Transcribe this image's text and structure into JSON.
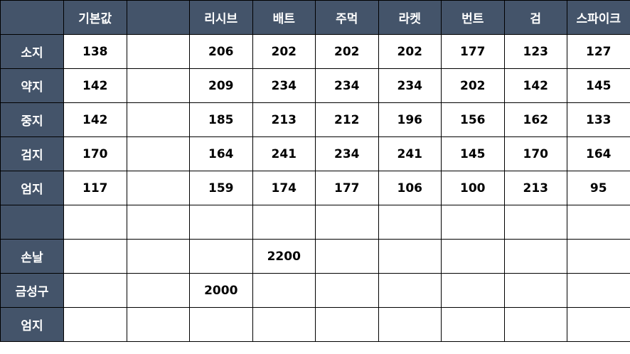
{
  "colors": {
    "header_bg": "#44546a",
    "header_text": "#ffffff",
    "cell_text": "#000000",
    "border": "#000000"
  },
  "table": {
    "columns": [
      "",
      "기본값",
      "",
      "리시브",
      "배트",
      "주먹",
      "라켓",
      "번트",
      "검",
      "스파이크"
    ],
    "rows": [
      {
        "label": "소지",
        "cells": [
          "138",
          "",
          "206",
          "202",
          "202",
          "202",
          "177",
          "123",
          "127"
        ]
      },
      {
        "label": "약지",
        "cells": [
          "142",
          "",
          "209",
          "234",
          "234",
          "234",
          "202",
          "142",
          "145"
        ]
      },
      {
        "label": "중지",
        "cells": [
          "142",
          "",
          "185",
          "213",
          "212",
          "196",
          "156",
          "162",
          "133"
        ]
      },
      {
        "label": "검지",
        "cells": [
          "170",
          "",
          "164",
          "241",
          "234",
          "241",
          "145",
          "170",
          "164"
        ]
      },
      {
        "label": "엄지",
        "cells": [
          "117",
          "",
          "159",
          "174",
          "177",
          "106",
          "100",
          "213",
          "95"
        ]
      },
      {
        "label": "",
        "cells": [
          "",
          "",
          "",
          "",
          "",
          "",
          "",
          "",
          ""
        ]
      },
      {
        "label": "손날",
        "cells": [
          "",
          "",
          "",
          "2200",
          "",
          "",
          "",
          "",
          ""
        ]
      },
      {
        "label": "금성구",
        "cells": [
          "",
          "",
          "2000",
          "",
          "",
          "",
          "",
          "",
          ""
        ]
      },
      {
        "label": "엄지",
        "cells": [
          "",
          "",
          "",
          "",
          "",
          "",
          "",
          "",
          ""
        ]
      }
    ]
  }
}
